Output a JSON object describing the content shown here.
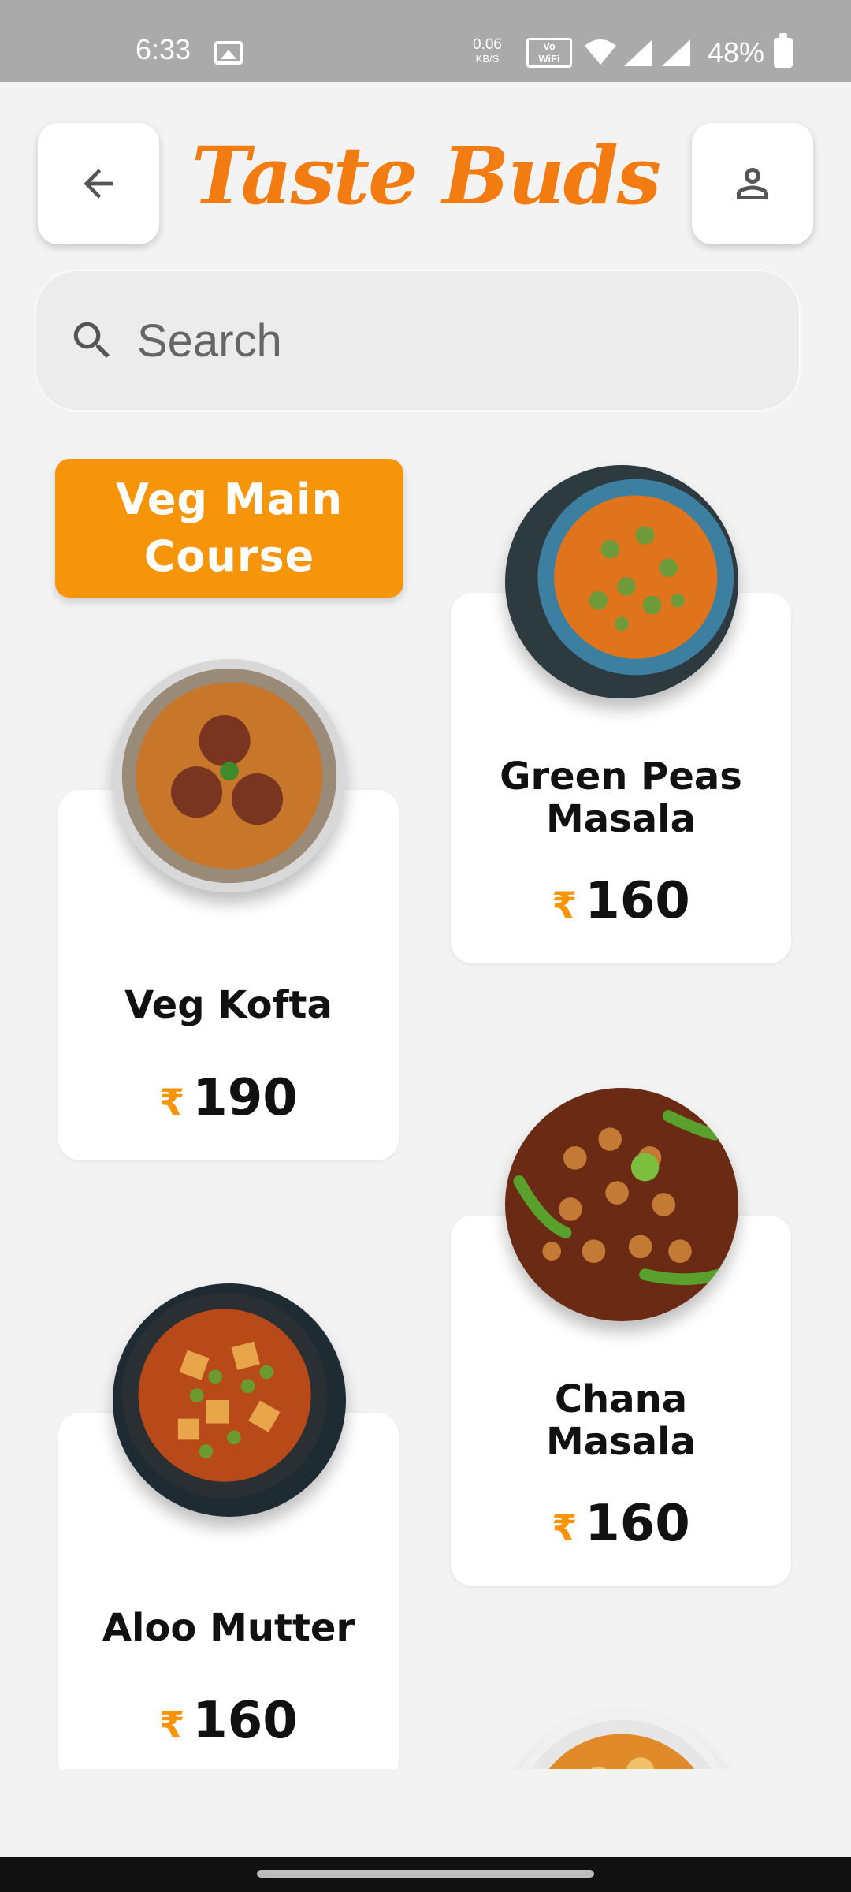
{
  "status_bar": {
    "time": "6:33",
    "net_speed_value": "0.06",
    "net_speed_unit": "KB/S",
    "volte": "Vo LTE WiFi 2",
    "battery": "48%"
  },
  "header": {
    "title": "Taste Buds",
    "back_icon": "arrow-left-icon",
    "profile_icon": "person-icon"
  },
  "search": {
    "placeholder": "Search",
    "value": ""
  },
  "category": {
    "label_line1": "Veg Main",
    "label_line2": "Course"
  },
  "currency_symbol": "₹",
  "products": [
    {
      "name": "Green Peas Masala",
      "price": "160"
    },
    {
      "name": "Veg Kofta",
      "price": "190"
    },
    {
      "name": "Chana Masala",
      "price": "160"
    },
    {
      "name": "Aloo Mutter",
      "price": "160"
    }
  ],
  "colors": {
    "accent": "#f7950a",
    "title": "#f27c12",
    "background": "#f3f3f3"
  }
}
